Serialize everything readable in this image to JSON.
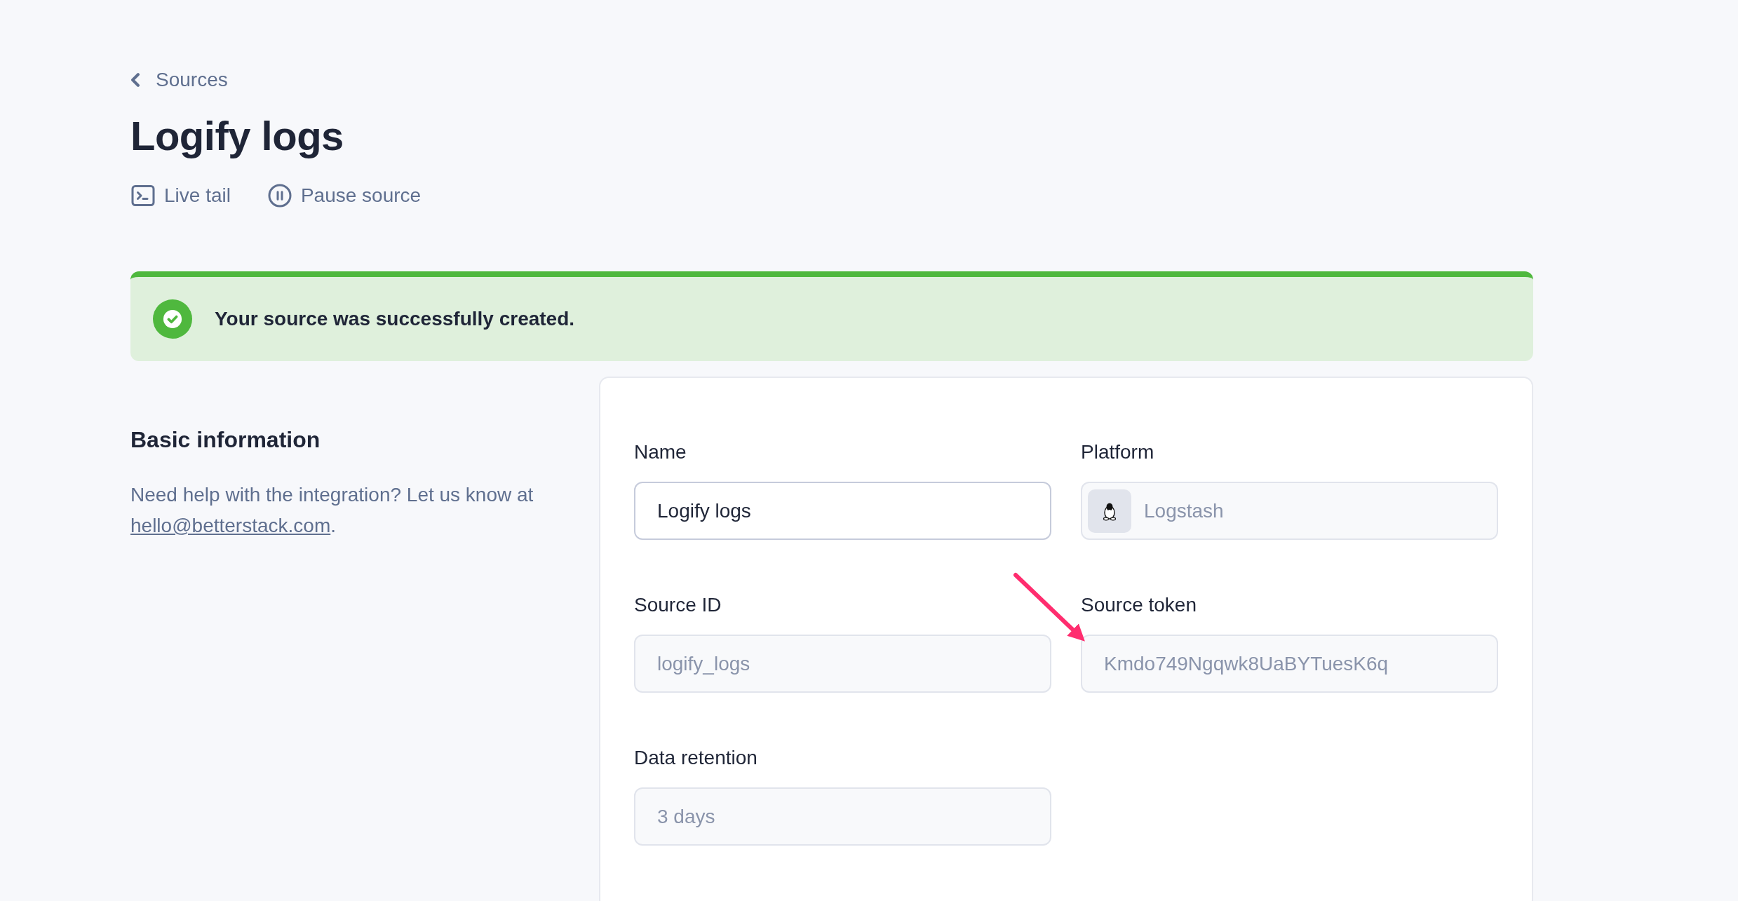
{
  "back_link": {
    "label": "Sources"
  },
  "title": "Logify logs",
  "actions": [
    {
      "kind": "terminal",
      "label": "Live tail"
    },
    {
      "kind": "pause",
      "label": "Pause source"
    }
  ],
  "alert": {
    "kind": "success",
    "message": "Your source was successfully created."
  },
  "section": {
    "heading": "Basic information",
    "help": "Need help with the integration? Let us know at ",
    "email": "hello@betterstack.com",
    "help_end": "."
  },
  "fields": [
    {
      "kind": "text",
      "label": "Name",
      "value": "Logify logs",
      "disabled": false
    },
    {
      "kind": "platform",
      "label": "Platform",
      "value": "Logstash",
      "disabled": true
    },
    {
      "kind": "text",
      "label": "Source ID",
      "value": "logify_logs",
      "disabled": true
    },
    {
      "kind": "text",
      "label": "Source token",
      "value": "Kmdo749Ngqwk8UaBYTuesK6q",
      "disabled": true
    },
    {
      "kind": "text",
      "label": "Data retention",
      "value": "3 days",
      "disabled": true
    }
  ]
}
